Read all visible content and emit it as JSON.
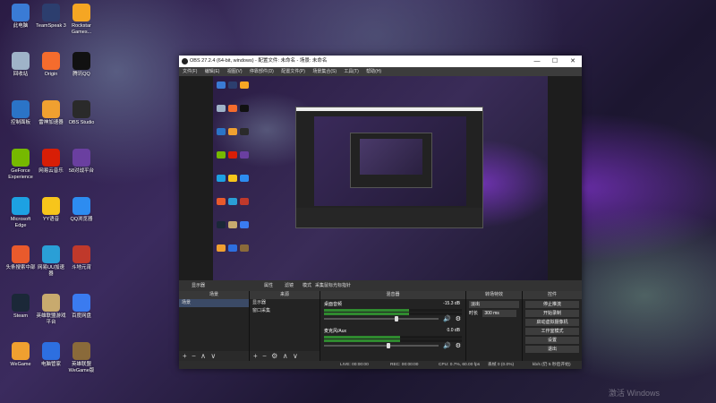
{
  "desktop": {
    "icons": [
      {
        "label": "此电脑",
        "color": "#3a7bd5"
      },
      {
        "label": "TeamSpeak 3",
        "color": "#2c3e6e"
      },
      {
        "label": "Rockstar Games...",
        "color": "#f5a623"
      },
      {
        "label": "回收站",
        "color": "#9fb3c8"
      },
      {
        "label": "Origin",
        "color": "#f56c2d"
      },
      {
        "label": "腾讯QQ",
        "color": "#111111"
      },
      {
        "label": "控制面板",
        "color": "#2b74c7"
      },
      {
        "label": "雷神加速器",
        "color": "#f0a030"
      },
      {
        "label": "OBS Studio",
        "color": "#2a2a2a"
      },
      {
        "label": "GeForce Experience",
        "color": "#76b900"
      },
      {
        "label": "网易云音乐",
        "color": "#d81e06"
      },
      {
        "label": "58对战平台",
        "color": "#6a3fa0"
      },
      {
        "label": "Microsoft Edge",
        "color": "#1da1e2"
      },
      {
        "label": "YY语音",
        "color": "#f7c51b"
      },
      {
        "label": "QQ浏览器",
        "color": "#2d8cf0"
      },
      {
        "label": "头条搜索中部",
        "color": "#e95a2c"
      },
      {
        "label": "网易UU加速器",
        "color": "#2a9fd6"
      },
      {
        "label": "斗地元宵",
        "color": "#c0392b"
      },
      {
        "label": "Steam",
        "color": "#1b2838"
      },
      {
        "label": "英雄联盟游戏平台",
        "color": "#c8aa6e"
      },
      {
        "label": "百度网盘",
        "color": "#3a7bf0"
      },
      {
        "label": "WeGame",
        "color": "#f0a030"
      },
      {
        "label": "电脑管家",
        "color": "#2d6fe0"
      },
      {
        "label": "英雄联盟WeGame版",
        "color": "#8a6a3a"
      }
    ],
    "watermark": "激活 Windows"
  },
  "window": {
    "title": "OBS 27.2.4 (64-bit, windows) - 配置文件: 未命名 - 场景: 未命名",
    "minimize": "—",
    "maximize": "☐",
    "close": "✕"
  },
  "menu": [
    "文件(F)",
    "编辑(E)",
    "视图(V)",
    "停靠部件(D)",
    "配置文件(P)",
    "场景集合(S)",
    "工具(T)",
    "帮助(H)"
  ],
  "source_bar": {
    "current_source": "显示器",
    "properties": "属性",
    "filters": "滤镜",
    "mode_label": "模式",
    "mode_value": "采集鼠标光标指针"
  },
  "docks": {
    "scenes": {
      "title": "场景",
      "items": [
        "场景"
      ]
    },
    "sources": {
      "title": "来源",
      "items": [
        "显示器",
        "窗口采集"
      ]
    },
    "mixer": {
      "title": "混音器",
      "channels": [
        {
          "name": "桌面音频",
          "db": "-15.3 dB",
          "level": 0.62
        },
        {
          "name": "麦克风/Aux",
          "db": "0.0 dB",
          "level": 0.55
        }
      ]
    },
    "transitions": {
      "title": "转场特效",
      "type": "淡出",
      "duration_label": "时长",
      "duration_value": "300 ms"
    },
    "controls": {
      "title": "控件",
      "buttons": [
        "停止推流",
        "开始录制",
        "启动虚拟摄像机",
        "工作室模式",
        "设置",
        "退出"
      ]
    }
  },
  "status": {
    "drops": "丢帧 0 (0.0%)",
    "live": "LIVE: 00:00:00",
    "rec": "REC: 00:00:00",
    "cpu": "CPU: 0.7%, 60.00 fps",
    "extra": "kb/s (仍 5 秒后开始)"
  },
  "colors": {
    "accent": "#3b4a66",
    "window_bg": "#2b2b2b"
  }
}
